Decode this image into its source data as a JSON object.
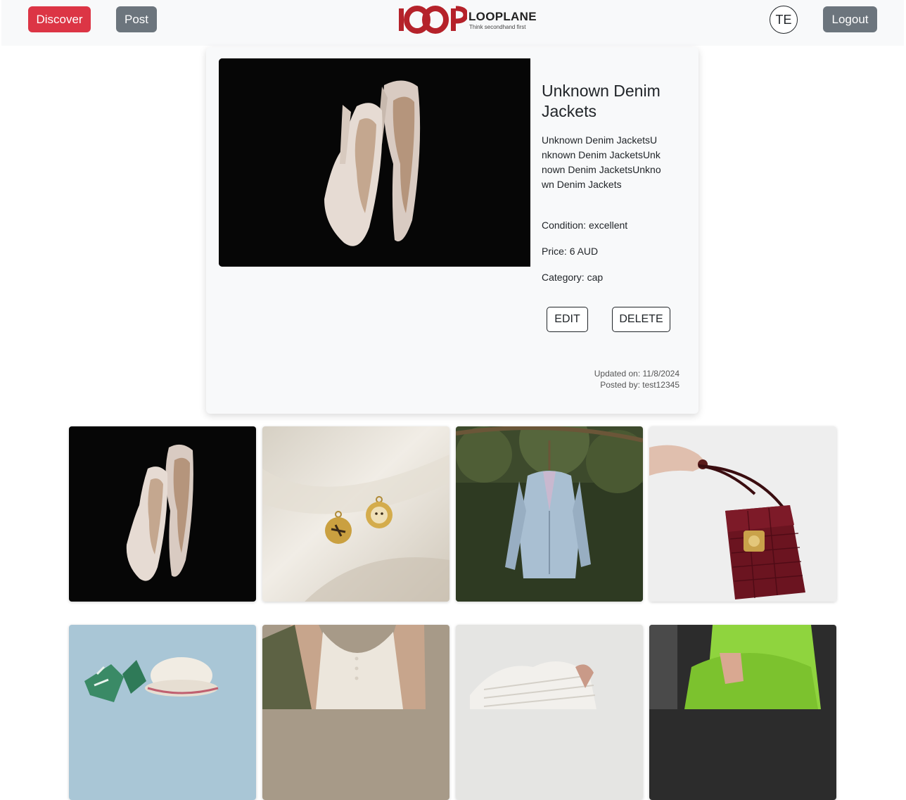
{
  "navbar": {
    "discover_label": "Discover",
    "post_label": "Post",
    "logout_label": "Logout",
    "avatar_initials": "TE",
    "logo_mark": "lOOP",
    "logo_name": "LOOPLANE",
    "logo_tagline": "Think secondhand first"
  },
  "listing": {
    "title": "Unknown Denim Jackets",
    "description": "Unknown Denim JacketsUnknown Denim JacketsUnknown Denim JacketsUnknown Denim Jackets",
    "condition_label": "Condition:",
    "condition_value": "excellent",
    "price_label": "Price:",
    "price_value": "6 AUD",
    "category_label": "Category:",
    "category_value": "cap",
    "edit_label": "EDIT",
    "delete_label": "DELETE",
    "updated_label": "Updated on:",
    "updated_value": "11/8/2024",
    "posted_label": "Posted by:",
    "posted_value": "test12345",
    "photo": "white-heels-photo"
  },
  "grid": {
    "tiles": [
      {
        "photo": "white-heels-photo"
      },
      {
        "photo": "gold-earrings-photo"
      },
      {
        "photo": "blue-blazer-photo"
      },
      {
        "photo": "croc-handbag-photo"
      },
      {
        "photo": "bow-hair-accessory-photo"
      },
      {
        "photo": "tank-top-bag-photo"
      },
      {
        "photo": "white-knit-photo"
      },
      {
        "photo": "green-bag-photo"
      }
    ]
  },
  "colors": {
    "discover": "#dc3545",
    "secondary": "#6c757d",
    "brand": "#b5222a",
    "navbar_bg": "#f8f9fa"
  }
}
